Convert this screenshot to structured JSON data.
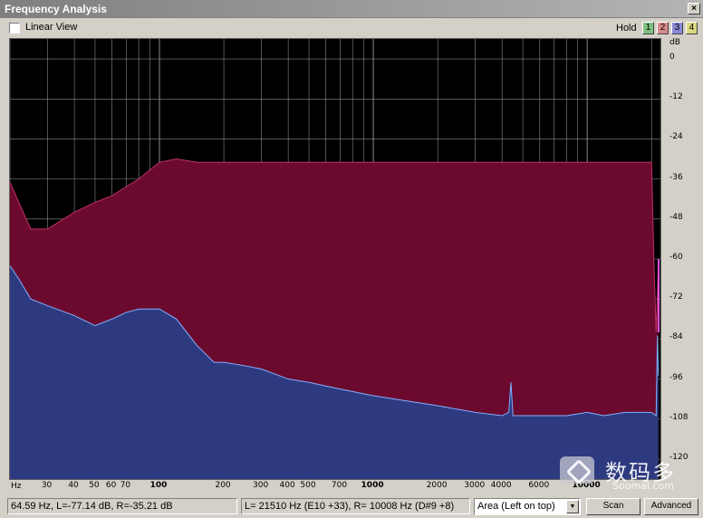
{
  "window": {
    "title": "Frequency Analysis",
    "close_glyph": "×"
  },
  "toolbar": {
    "linear_view_label": "Linear View",
    "linear_view_checked": false,
    "hold_label": "Hold",
    "hold_buttons": [
      {
        "label": "1",
        "color": "#7fbf7f"
      },
      {
        "label": "2",
        "color": "#d98a8a"
      },
      {
        "label": "3",
        "color": "#8a8ad9"
      },
      {
        "label": "4",
        "color": "#d9d97f"
      }
    ]
  },
  "status": {
    "cursor_readout": "64.59 Hz, L=-77.14 dB, R=-35.21 dB",
    "peak_readout": "L=  21510 Hz (E10 +33), R=  10008 Hz (D#9 +8)",
    "view_mode_selected": "Area (Left on top)",
    "scan_label": "Scan",
    "advanced_label": "Advanced"
  },
  "watermark": {
    "cn": "数码多",
    "en": "Soomal.com"
  },
  "colors": {
    "background": "#000000",
    "grid": "#8a8a8a",
    "left_channel_fill": "#2e3a80",
    "left_channel_edge": "#7fb0ff",
    "right_channel_fill": "#6b0a2e",
    "right_channel_edge": "#c0306a",
    "right_channel_spike": "#e050e0"
  },
  "chart_data": {
    "type": "area",
    "xscale": "log",
    "x_unit": "Hz",
    "y_unit": "dB",
    "xlim": [
      20,
      22000
    ],
    "ylim": [
      -126,
      6
    ],
    "x_ticks": [
      30,
      40,
      50,
      60,
      70,
      100,
      200,
      300,
      400,
      500,
      700,
      1000,
      2000,
      3000,
      4000,
      6000,
      10000
    ],
    "x_ticks_major": [
      100,
      1000,
      10000
    ],
    "y_ticks": [
      0,
      -12,
      -24,
      -36,
      -48,
      -60,
      -72,
      -84,
      -96,
      -108,
      -120
    ],
    "grid": true,
    "series": [
      {
        "channel": "right",
        "x": [
          20,
          22,
          25,
          30,
          40,
          50,
          60,
          80,
          100,
          120,
          150,
          200,
          500,
          1000,
          5000,
          10000,
          15000,
          19000,
          20000,
          20500,
          21000,
          21510
        ],
        "y": [
          -37,
          -43,
          -51,
          -51,
          -46,
          -43,
          -41,
          -36,
          -31,
          -30,
          -31,
          -31,
          -31,
          -31,
          -31,
          -31,
          -31,
          -31,
          -31,
          -60,
          -82,
          -62
        ]
      },
      {
        "channel": "left",
        "x": [
          20,
          22,
          25,
          30,
          40,
          50,
          60,
          70,
          80,
          100,
          120,
          150,
          180,
          200,
          250,
          300,
          400,
          500,
          700,
          1000,
          2000,
          3000,
          4000,
          4300,
          4400,
          4500,
          6000,
          8000,
          10000,
          12000,
          15000,
          20000,
          21000,
          21300,
          21510
        ],
        "y": [
          -62,
          -66,
          -72,
          -74,
          -77,
          -80,
          -78,
          -76,
          -75,
          -75,
          -78,
          -86,
          -91,
          -91,
          -92,
          -93,
          -96,
          -97,
          -99,
          -101,
          -104,
          -106,
          -107,
          -106,
          -97,
          -107,
          -107,
          -107,
          -106,
          -107,
          -106,
          -106,
          -107,
          -83,
          -95
        ]
      }
    ]
  }
}
